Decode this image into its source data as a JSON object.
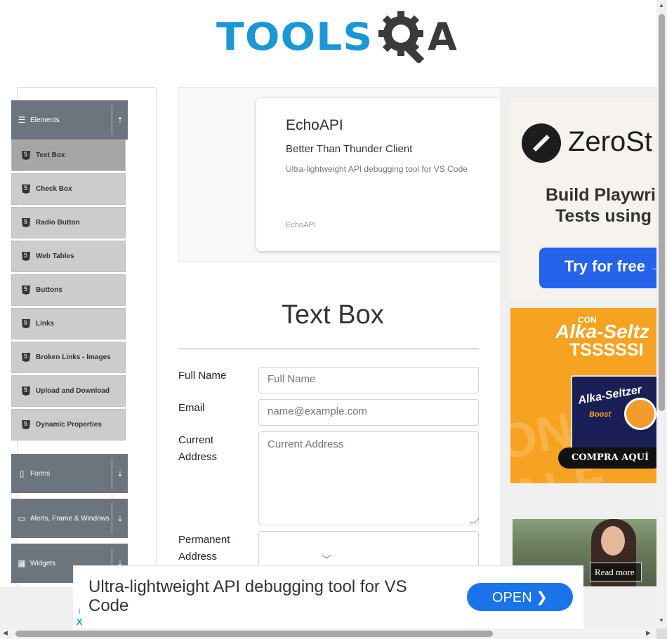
{
  "logo": {
    "text": "TOOLS",
    "suffix": "A"
  },
  "sidebar": {
    "elements_group": "Elements",
    "items": [
      {
        "label": "Text Box",
        "active": true
      },
      {
        "label": "Check Box"
      },
      {
        "label": "Radio Button"
      },
      {
        "label": "Web Tables"
      },
      {
        "label": "Buttons"
      },
      {
        "label": "Links"
      },
      {
        "label": "Broken Links - Images"
      },
      {
        "label": "Upload and Download"
      },
      {
        "label": "Dynamic Properties"
      }
    ],
    "groups": [
      {
        "label": "Forms",
        "icon": "document-icon"
      },
      {
        "label": "Alerts, Frame & Windows",
        "icon": "window-icon"
      },
      {
        "label": "Widgets",
        "icon": "grid-icon"
      }
    ]
  },
  "ad_card": {
    "title": "EchoAPI",
    "subtitle": "Better Than Thunder Client",
    "description": "Ultra-lightweight API debugging tool for VS Code",
    "brand": "EchoAPI"
  },
  "zero_ad": {
    "name": "ZeroSt",
    "line1": "Build Playwri",
    "line2": "Tests using",
    "button": "Try for free"
  },
  "alka_ad": {
    "con": "CON",
    "title": "Alka-Seltz",
    "tss": "TSSSSSI",
    "box_title": "Alka-Seltzer",
    "box_sub": "Boost",
    "button": "COMPRA AQUÍ"
  },
  "news_ad": {
    "read_more": "Read more"
  },
  "main": {
    "title": "Text Box",
    "fields": {
      "full_name_label": "Full Name",
      "full_name_placeholder": "Full Name",
      "email_label": "Email",
      "email_placeholder": "name@example.com",
      "current_address_label_1": "Current",
      "current_address_label_2": "Address",
      "current_address_placeholder": "Current Address",
      "permanent_address_label_1": "Permanent",
      "permanent_address_label_2": "Address"
    }
  },
  "bottom_ad": {
    "text": "Ultra-lightweight API debugging tool for VS Code",
    "button": "OPEN",
    "info": "i",
    "close": "X"
  },
  "colors": {
    "brand_blue": "#1c97d6",
    "sidebar_header": "#6c757d",
    "menu_item": "#cccccc",
    "menu_item_active": "#a6a6a6",
    "open_button": "#1a73e8",
    "zero_button": "#2563eb",
    "alka_orange": "#f5a321"
  }
}
